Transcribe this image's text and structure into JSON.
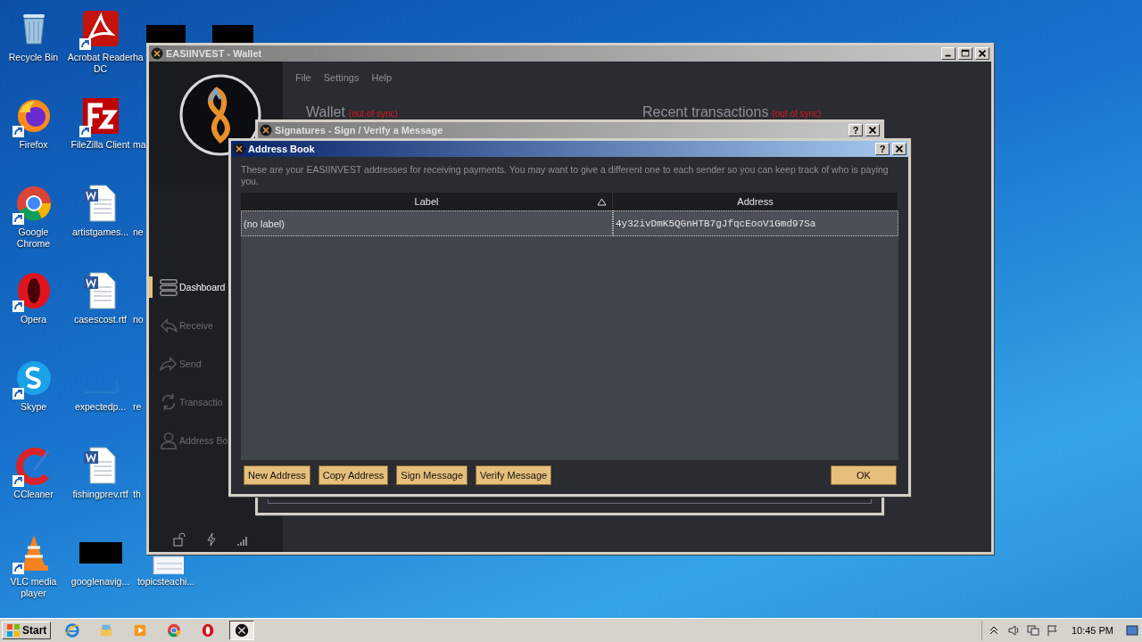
{
  "desktop": {
    "icon_columns": [
      {
        "icons": [
          {
            "label": "Recycle Bin",
            "kind": "bin",
            "shortcut": false
          },
          {
            "label": "Firefox",
            "kind": "firefox",
            "shortcut": true
          },
          {
            "label": "Google Chrome",
            "kind": "chrome",
            "shortcut": true
          },
          {
            "label": "Opera",
            "kind": "opera",
            "shortcut": true
          },
          {
            "label": "Skype",
            "kind": "skype",
            "shortcut": true
          },
          {
            "label": "CCleaner",
            "kind": "ccleaner",
            "shortcut": true
          },
          {
            "label": "VLC media player",
            "kind": "vlc",
            "shortcut": true
          }
        ]
      },
      {
        "icons": [
          {
            "label": "Acrobat Reader DC",
            "kind": "pdf",
            "shortcut": true
          },
          {
            "label": "FileZilla Client",
            "kind": "filezilla",
            "shortcut": true
          },
          {
            "label": "artistgames...",
            "kind": "word",
            "shortcut": false
          },
          {
            "label": "casescost.rtf",
            "kind": "word",
            "shortcut": false
          },
          {
            "label": "expectedp...",
            "kind": "blank",
            "shortcut": false
          },
          {
            "label": "fishingprev.rtf",
            "kind": "word",
            "shortcut": false
          },
          {
            "label": "googlenavig...",
            "kind": "redacted",
            "shortcut": false
          }
        ]
      }
    ],
    "covered_labels": [
      "ha",
      "ma",
      "ne",
      "no",
      "re",
      "th"
    ],
    "bottom_icon": {
      "label": "topicsteachi...",
      "kind": "doc"
    }
  },
  "wallet": {
    "title": "EASIINVEST - Wallet",
    "menu": [
      "File",
      "Settings",
      "Help"
    ],
    "sidebar": [
      {
        "label": "Dashboard",
        "kind": "dashboard",
        "selected": true
      },
      {
        "label": "Receive",
        "kind": "receive",
        "selected": false
      },
      {
        "label": "Send",
        "kind": "send",
        "selected": false
      },
      {
        "label": "Transactio",
        "kind": "transactions",
        "selected": false
      },
      {
        "label": "Address Bo",
        "kind": "addressbook",
        "selected": false
      }
    ],
    "panels": [
      {
        "title": "Wallet",
        "status": "(out of sync)"
      },
      {
        "title": "Recent transactions",
        "status": "(out of sync)"
      }
    ]
  },
  "signatures_window": {
    "title": "Signatures - Sign / Verify a Message",
    "help": "?"
  },
  "address_book": {
    "title": "Address Book",
    "help": "?",
    "description": "These are your EASIINVEST addresses for receiving payments. You may want to give a different one to each sender so you can keep track of who is paying you.",
    "table": {
      "columns": [
        {
          "label": "Label",
          "sorted": true
        },
        {
          "label": "Address",
          "sorted": false
        }
      ],
      "rows": [
        {
          "label": "(no label)",
          "address": "4y32ivDmK5QGnHTB7gJfqcEooV1Gmd97Sa",
          "selected": true
        }
      ]
    },
    "buttons": [
      "New Address",
      "Copy Address",
      "Sign Message",
      "Verify Message"
    ],
    "ok": "OK"
  },
  "taskbar": {
    "start": "Start",
    "apps": [
      {
        "kind": "ie",
        "selected": false
      },
      {
        "kind": "explorer",
        "selected": false
      },
      {
        "kind": "media",
        "selected": false
      },
      {
        "kind": "chrome",
        "selected": false
      },
      {
        "kind": "opera",
        "selected": false
      },
      {
        "kind": "wallet",
        "selected": true
      }
    ],
    "time": "10:45 PM"
  }
}
